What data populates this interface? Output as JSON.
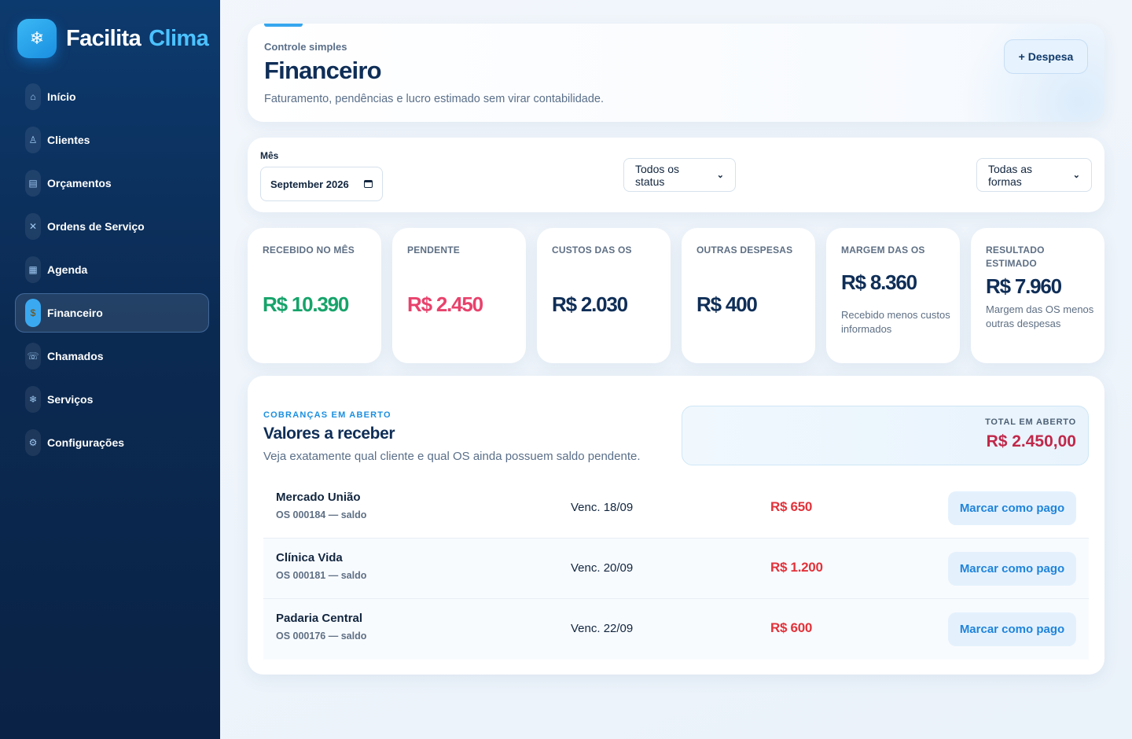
{
  "brand": {
    "name": "Facilita",
    "accent": "Clima",
    "logo_icon": "snowflake-icon"
  },
  "sidebar": {
    "items": [
      {
        "label": "Início",
        "icon": "home-icon",
        "glyph": "⌂",
        "active": false
      },
      {
        "label": "Clientes",
        "icon": "user-icon",
        "glyph": "♙",
        "active": false
      },
      {
        "label": "Orçamentos",
        "icon": "receipt-icon",
        "glyph": "▤",
        "active": false
      },
      {
        "label": "Ordens de Serviço",
        "icon": "tools-icon",
        "glyph": "✕",
        "active": false
      },
      {
        "label": "Agenda",
        "icon": "calendar-icon",
        "glyph": "▦",
        "active": false
      },
      {
        "label": "Financeiro",
        "icon": "money-bag-icon",
        "glyph": "$",
        "active": true
      },
      {
        "label": "Chamados",
        "icon": "phone-icon",
        "glyph": "☏",
        "active": false
      },
      {
        "label": "Serviços",
        "icon": "snowflake-icon",
        "glyph": "❄",
        "active": false
      },
      {
        "label": "Configurações",
        "icon": "gear-icon",
        "glyph": "⚙",
        "active": false
      }
    ]
  },
  "header": {
    "eyebrow": "Controle simples",
    "title": "Financeiro",
    "subtitle": "Faturamento, pendências e lucro estimado sem virar contabilidade.",
    "add_expense_label": "+ Despesa"
  },
  "filters": {
    "month_label": "Mês",
    "month_value": "September 2026",
    "status_select": "Todos os status",
    "payment_select": "Todas as formas"
  },
  "stats": [
    {
      "label": "RECEBIDO NO MÊS",
      "value": "R$ 10.390",
      "color": "#16a36a",
      "note": ""
    },
    {
      "label": "PENDENTE",
      "value": "R$ 2.450",
      "color": "#e8426c",
      "note": ""
    },
    {
      "label": "CUSTOS DAS OS",
      "value": "R$ 2.030",
      "color": "#0f2e57",
      "note": ""
    },
    {
      "label": "OUTRAS DESPESAS",
      "value": "R$ 400",
      "color": "#0f2e57",
      "note": ""
    },
    {
      "label": "MARGEM DAS OS",
      "value": "R$ 8.360",
      "color": "#0f2e57",
      "note": "Recebido menos custos informados"
    },
    {
      "label": "RESULTADO ESTIMADO",
      "value": "R$ 7.960",
      "color": "#0f2e57",
      "note": "Margem das OS menos outras despesas"
    }
  ],
  "receivables": {
    "eyebrow": "COBRANÇAS EM ABERTO",
    "title": "Valores a receber",
    "subtitle": "Veja exatamente qual cliente e qual OS ainda possuem saldo pendente.",
    "total_label": "TOTAL EM ABERTO",
    "total_value": "R$ 2.450,00",
    "rows": [
      {
        "client": "Mercado União",
        "os": "OS 000184 — saldo",
        "due": "Venc. 18/09",
        "amount": "R$ 650",
        "action": "Marcar como pago"
      },
      {
        "client": "Clínica Vida",
        "os": "OS 000181 — saldo",
        "due": "Venc. 20/09",
        "amount": "R$ 1.200",
        "action": "Marcar como pago"
      },
      {
        "client": "Padaria Central",
        "os": "OS 000176 — saldo",
        "due": "Venc. 22/09",
        "amount": "R$ 600",
        "action": "Marcar como pago"
      }
    ]
  }
}
